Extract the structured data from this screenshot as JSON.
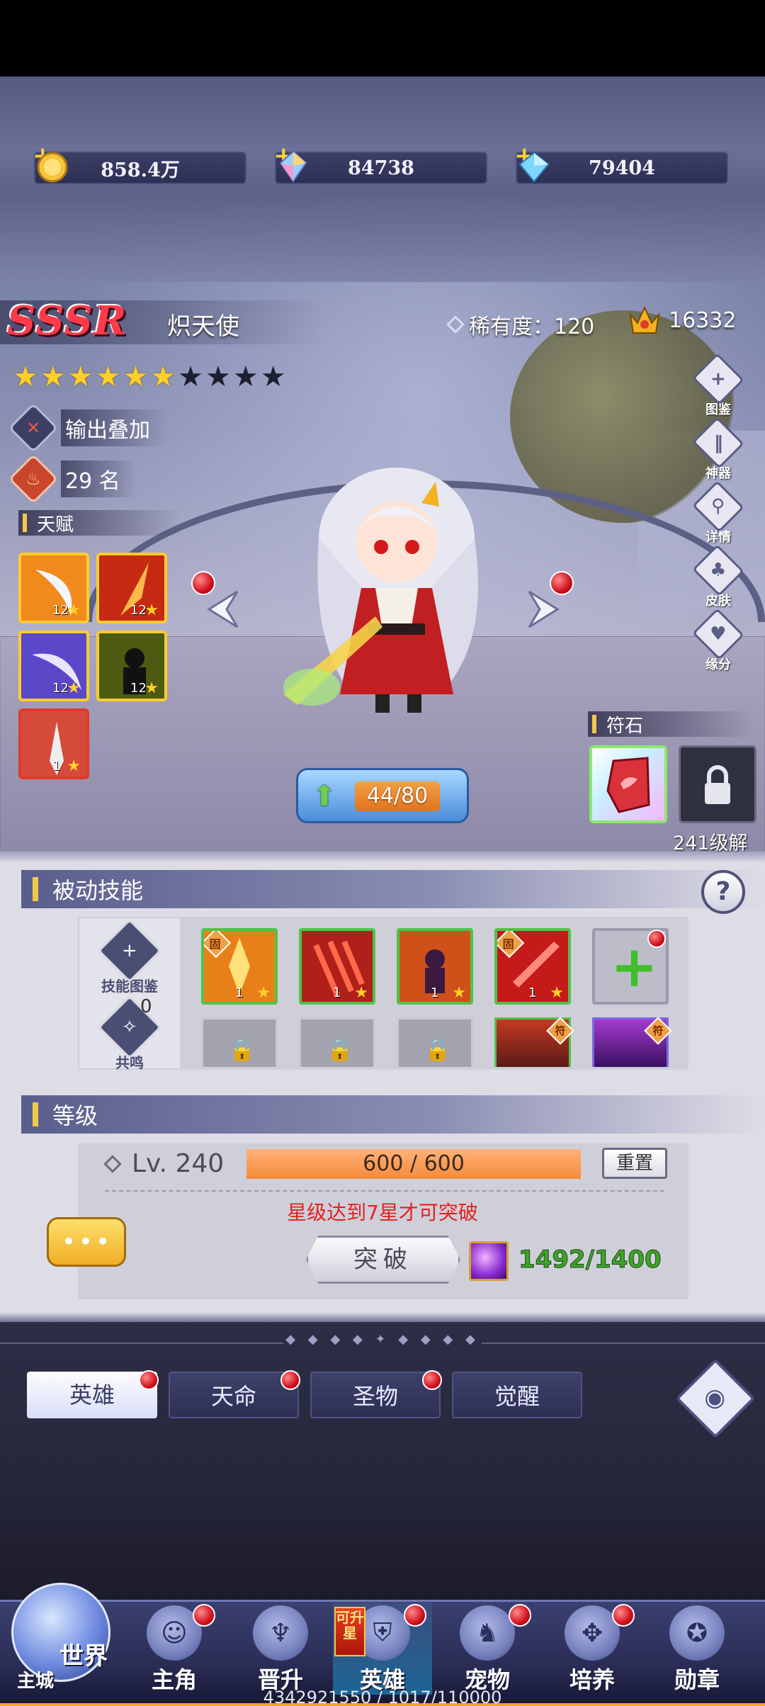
{
  "currencies": [
    {
      "icon": "gold-coin-icon",
      "value": "858.4万"
    },
    {
      "icon": "rainbow-crystal-icon",
      "value": "84738"
    },
    {
      "icon": "blue-diamond-icon",
      "value": "79404"
    }
  ],
  "hero": {
    "rarity_grade": "SSSR",
    "name": "炽天使",
    "rarity_label": "稀有度：120",
    "power": "16332",
    "stars_total": 10,
    "stars_lit": 6,
    "role_tag": "输出叠加",
    "rank": "29 名",
    "talent_title": "天赋",
    "talents": [
      {
        "icon": "curved-blade-icon",
        "level": "12",
        "color": "#f08a1a"
      },
      {
        "icon": "flame-slash-icon",
        "level": "12",
        "color": "#c62a12"
      },
      {
        "icon": "wind-crescent-icon",
        "level": "12",
        "color": "#5a48c8"
      },
      {
        "icon": "shadow-figure-icon",
        "level": "12",
        "color": "#4d5a12"
      },
      {
        "icon": "winged-sword-icon",
        "level": "1",
        "color": "#d64a3a"
      }
    ],
    "level_progress": "44/80",
    "side_buttons": [
      {
        "icon": "codex-icon",
        "label": "图鉴"
      },
      {
        "icon": "artifact-icon",
        "label": "神器"
      },
      {
        "icon": "magnifier-icon",
        "label": "详情"
      },
      {
        "icon": "skin-icon",
        "label": "皮肤"
      },
      {
        "icon": "heart-bond-icon",
        "label": "缘分"
      }
    ],
    "rune_title": "符石",
    "rune_unlock_text": "241级解锁"
  },
  "passive": {
    "title": "被动技能",
    "help": "?",
    "codex_label": "技能图鉴",
    "resonance_label": "共鸣",
    "resonance_count": "0",
    "fixed_tag": "固",
    "rune_tag": "符",
    "skills": [
      {
        "icon": "fire-burst-icon",
        "level": "1",
        "fixed": true,
        "color": "#e8801a"
      },
      {
        "icon": "claw-slash-icon",
        "level": "1",
        "fixed": false,
        "color": "#b0201a"
      },
      {
        "icon": "fire-warrior-icon",
        "level": "1",
        "fixed": false,
        "color": "#d0501a"
      },
      {
        "icon": "red-sword-icon",
        "level": "1",
        "fixed": true,
        "color": "#c41a1a"
      }
    ],
    "add_icon": "+"
  },
  "level": {
    "title": "等级",
    "lv_label": "Lv. 240",
    "exp_text": "600 / 600",
    "exp_fraction": 1.0,
    "reset_label": "重置",
    "warning": "星级达到7星才可突破",
    "chat_dots": "•••",
    "breakthrough_label": "突破",
    "material_count": "1492/1400"
  },
  "tabs": [
    {
      "label": "英雄",
      "active": true,
      "dot": true
    },
    {
      "label": "天命",
      "active": false,
      "dot": true
    },
    {
      "label": "圣物",
      "active": false,
      "dot": true
    },
    {
      "label": "觉醒",
      "active": false,
      "dot": false
    }
  ],
  "ornament": "◆ ◆ ◆ ◆ ✦ ◆ ◆ ◆ ◆",
  "nav": {
    "world_label": "世界",
    "city_label": "主城",
    "upgrade_badge": "可升星",
    "items": [
      {
        "label": "主角",
        "icon": "hero-face-icon",
        "dot": true,
        "active": false
      },
      {
        "label": "晋升",
        "icon": "wings-crest-icon",
        "dot": false,
        "active": false
      },
      {
        "label": "英雄",
        "icon": "helmet-icon",
        "dot": true,
        "active": true
      },
      {
        "label": "宠物",
        "icon": "pet-icon",
        "dot": true,
        "active": false
      },
      {
        "label": "培养",
        "icon": "compass-icon",
        "dot": true,
        "active": false
      },
      {
        "label": "勋章",
        "icon": "medal-icon",
        "dot": false,
        "active": false
      }
    ]
  },
  "debug_text": "4342921550 / 1017/110000"
}
